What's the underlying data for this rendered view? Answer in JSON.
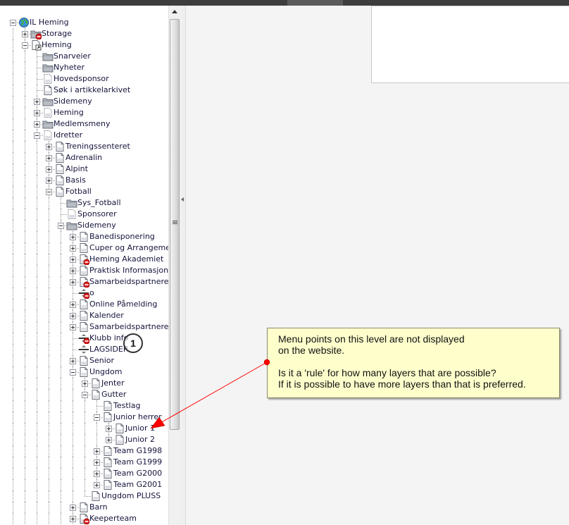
{
  "tree": [
    {
      "label": "IL Heming",
      "level": 0,
      "expander": "minus",
      "icon": "globe"
    },
    {
      "label": "Storage",
      "level": 1,
      "expander": "plus",
      "icon": "folder",
      "restricted": true
    },
    {
      "label": "Heming",
      "level": 1,
      "expander": "minus",
      "icon": "page-link"
    },
    {
      "label": "Snarveier",
      "level": 2,
      "expander": "none",
      "icon": "folder"
    },
    {
      "label": "Nyheter",
      "level": 2,
      "expander": "none",
      "icon": "folder"
    },
    {
      "label": "Hovedsponsor",
      "level": 2,
      "expander": "none",
      "icon": "page-dotted"
    },
    {
      "label": "Søk i artikkelarkivet",
      "level": 2,
      "expander": "none",
      "icon": "page"
    },
    {
      "label": "Sidemeny",
      "level": 2,
      "expander": "plus",
      "icon": "folder"
    },
    {
      "label": "Heming",
      "level": 2,
      "expander": "plus",
      "icon": "page-dotted"
    },
    {
      "label": "Medlemsmeny",
      "level": 2,
      "expander": "plus",
      "icon": "folder"
    },
    {
      "label": "Idretter",
      "level": 2,
      "expander": "minus",
      "icon": "page-dotted"
    },
    {
      "label": "Treningssenteret",
      "level": 3,
      "expander": "plus",
      "icon": "page"
    },
    {
      "label": "Adrenalin",
      "level": 3,
      "expander": "plus",
      "icon": "page"
    },
    {
      "label": "Alpint",
      "level": 3,
      "expander": "plus",
      "icon": "page"
    },
    {
      "label": "Basis",
      "level": 3,
      "expander": "plus",
      "icon": "page"
    },
    {
      "label": "Fotball",
      "level": 3,
      "expander": "minus",
      "icon": "page"
    },
    {
      "label": "Sys_Fotball",
      "level": 4,
      "expander": "none",
      "icon": "folder"
    },
    {
      "label": "Sponsorer",
      "level": 4,
      "expander": "none",
      "icon": "page-dotted"
    },
    {
      "label": "Sidemeny",
      "level": 4,
      "expander": "minus",
      "icon": "folder"
    },
    {
      "label": "Banedisponering",
      "level": 5,
      "expander": "plus",
      "icon": "page"
    },
    {
      "label": "Cuper og Arrangeme",
      "level": 5,
      "expander": "plus",
      "icon": "page"
    },
    {
      "label": "Heming Akademiet",
      "level": 5,
      "expander": "plus",
      "icon": "page",
      "restricted": true
    },
    {
      "label": "Praktisk Informasjon",
      "level": 5,
      "expander": "plus",
      "icon": "page"
    },
    {
      "label": "Samarbeidspartnere",
      "level": 5,
      "expander": "plus",
      "icon": "page",
      "restricted": true
    },
    {
      "label": "o",
      "level": 5,
      "expander": "none",
      "icon": "separator",
      "restricted": true
    },
    {
      "label": "Online Påmelding",
      "level": 5,
      "expander": "plus",
      "icon": "page"
    },
    {
      "label": "Kalender",
      "level": 5,
      "expander": "plus",
      "icon": "page"
    },
    {
      "label": "Samarbeidspartnere",
      "level": 5,
      "expander": "plus",
      "icon": "page"
    },
    {
      "label": "Klubb info",
      "level": 5,
      "expander": "none",
      "icon": "separator",
      "restricted": true
    },
    {
      "label": "LAGSIDER",
      "level": 5,
      "expander": "none",
      "icon": "separator"
    },
    {
      "label": "Senior",
      "level": 5,
      "expander": "plus",
      "icon": "page"
    },
    {
      "label": "Ungdom",
      "level": 5,
      "expander": "minus",
      "icon": "page"
    },
    {
      "label": "Jenter",
      "level": 6,
      "expander": "plus",
      "icon": "page"
    },
    {
      "label": "Gutter",
      "level": 6,
      "expander": "minus",
      "icon": "page"
    },
    {
      "label": "Testlag",
      "level": 7,
      "expander": "none",
      "icon": "page"
    },
    {
      "label": "Junior herrer",
      "level": 7,
      "expander": "minus",
      "icon": "page"
    },
    {
      "label": "Junior 1",
      "level": 8,
      "expander": "plus",
      "icon": "page"
    },
    {
      "label": "Junior 2",
      "level": 8,
      "expander": "plus",
      "icon": "page"
    },
    {
      "label": "Team G1998",
      "level": 7,
      "expander": "plus",
      "icon": "page"
    },
    {
      "label": "Team G1999",
      "level": 7,
      "expander": "plus",
      "icon": "page"
    },
    {
      "label": "Team G2000",
      "level": 7,
      "expander": "plus",
      "icon": "page"
    },
    {
      "label": "Team G2001",
      "level": 7,
      "expander": "plus",
      "icon": "page"
    },
    {
      "label": "Ungdom PLUSS",
      "level": 6,
      "expander": "none",
      "icon": "page"
    },
    {
      "label": "Barn",
      "level": 5,
      "expander": "plus",
      "icon": "page"
    },
    {
      "label": "Keeperteam",
      "level": 5,
      "expander": "plus",
      "icon": "page",
      "restricted": true
    }
  ],
  "annotation": {
    "marker_number": "1",
    "note_lines_1": [
      "Menu points on this level are not displayed",
      "on the website."
    ],
    "note_lines_2": [
      "Is it a 'rule' for how many layers that are possible?",
      "If it is possible to have more layers than that is preferred."
    ],
    "note_background": "#ffffcc",
    "arrow_color": "#ff0000"
  },
  "colors": {
    "topbar": "#3d3d3d",
    "restricted_badge": "#e02020",
    "tree_text": "#14143c"
  }
}
